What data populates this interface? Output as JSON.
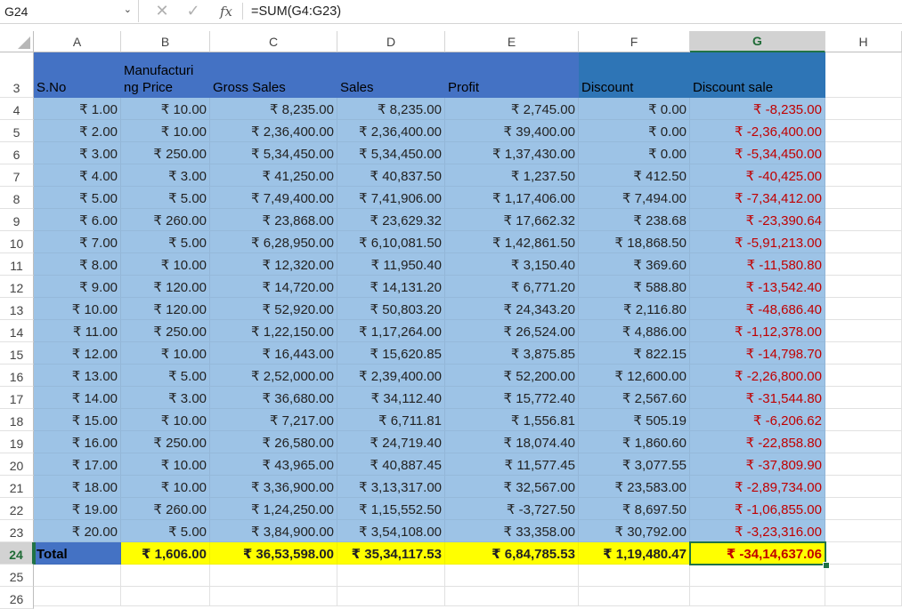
{
  "formula_bar": {
    "name_box": "G24",
    "fx_label": "fx",
    "formula": "=SUM(G4:G23)",
    "cancel_glyph": "✕",
    "enter_glyph": "✓",
    "chevron": "⌄"
  },
  "columns": [
    "A",
    "B",
    "C",
    "D",
    "E",
    "F",
    "G",
    "H"
  ],
  "selected_column": "G",
  "rows": [
    "3",
    "4",
    "5",
    "6",
    "7",
    "8",
    "9",
    "10",
    "11",
    "12",
    "13",
    "14",
    "15",
    "16",
    "17",
    "18",
    "19",
    "20",
    "21",
    "22",
    "23",
    "24",
    "25",
    "26"
  ],
  "selected_row": "24",
  "headers": [
    "S.No",
    "Manufacturing Price",
    "Gross Sales",
    "Sales",
    "Profit",
    "Discount",
    "Discount sale"
  ],
  "header_display": [
    "S.No",
    "Manufacturi ng Price",
    "Gross Sales",
    "Sales",
    "Profit",
    "Discount",
    "Discount sale"
  ],
  "data": [
    [
      "₹ 1.00",
      "₹ 10.00",
      "₹ 8,235.00",
      "₹ 8,235.00",
      "₹ 2,745.00",
      "₹ 0.00",
      "₹ -8,235.00"
    ],
    [
      "₹ 2.00",
      "₹ 10.00",
      "₹ 2,36,400.00",
      "₹ 2,36,400.00",
      "₹ 39,400.00",
      "₹ 0.00",
      "₹ -2,36,400.00"
    ],
    [
      "₹ 3.00",
      "₹ 250.00",
      "₹ 5,34,450.00",
      "₹ 5,34,450.00",
      "₹ 1,37,430.00",
      "₹ 0.00",
      "₹ -5,34,450.00"
    ],
    [
      "₹ 4.00",
      "₹ 3.00",
      "₹ 41,250.00",
      "₹ 40,837.50",
      "₹ 1,237.50",
      "₹ 412.50",
      "₹ -40,425.00"
    ],
    [
      "₹ 5.00",
      "₹ 5.00",
      "₹ 7,49,400.00",
      "₹ 7,41,906.00",
      "₹ 1,17,406.00",
      "₹ 7,494.00",
      "₹ -7,34,412.00"
    ],
    [
      "₹ 6.00",
      "₹ 260.00",
      "₹ 23,868.00",
      "₹ 23,629.32",
      "₹ 17,662.32",
      "₹ 238.68",
      "₹ -23,390.64"
    ],
    [
      "₹ 7.00",
      "₹ 5.00",
      "₹ 6,28,950.00",
      "₹ 6,10,081.50",
      "₹ 1,42,861.50",
      "₹ 18,868.50",
      "₹ -5,91,213.00"
    ],
    [
      "₹ 8.00",
      "₹ 10.00",
      "₹ 12,320.00",
      "₹ 11,950.40",
      "₹ 3,150.40",
      "₹ 369.60",
      "₹ -11,580.80"
    ],
    [
      "₹ 9.00",
      "₹ 120.00",
      "₹ 14,720.00",
      "₹ 14,131.20",
      "₹ 6,771.20",
      "₹ 588.80",
      "₹ -13,542.40"
    ],
    [
      "₹ 10.00",
      "₹ 120.00",
      "₹ 52,920.00",
      "₹ 50,803.20",
      "₹ 24,343.20",
      "₹ 2,116.80",
      "₹ -48,686.40"
    ],
    [
      "₹ 11.00",
      "₹ 250.00",
      "₹ 1,22,150.00",
      "₹ 1,17,264.00",
      "₹ 26,524.00",
      "₹ 4,886.00",
      "₹ -1,12,378.00"
    ],
    [
      "₹ 12.00",
      "₹ 10.00",
      "₹ 16,443.00",
      "₹ 15,620.85",
      "₹ 3,875.85",
      "₹ 822.15",
      "₹ -14,798.70"
    ],
    [
      "₹ 13.00",
      "₹ 5.00",
      "₹ 2,52,000.00",
      "₹ 2,39,400.00",
      "₹ 52,200.00",
      "₹ 12,600.00",
      "₹ -2,26,800.00"
    ],
    [
      "₹ 14.00",
      "₹ 3.00",
      "₹ 36,680.00",
      "₹ 34,112.40",
      "₹ 15,772.40",
      "₹ 2,567.60",
      "₹ -31,544.80"
    ],
    [
      "₹ 15.00",
      "₹ 10.00",
      "₹ 7,217.00",
      "₹ 6,711.81",
      "₹ 1,556.81",
      "₹ 505.19",
      "₹ -6,206.62"
    ],
    [
      "₹ 16.00",
      "₹ 250.00",
      "₹ 26,580.00",
      "₹ 24,719.40",
      "₹ 18,074.40",
      "₹ 1,860.60",
      "₹ -22,858.80"
    ],
    [
      "₹ 17.00",
      "₹ 10.00",
      "₹ 43,965.00",
      "₹ 40,887.45",
      "₹ 11,577.45",
      "₹ 3,077.55",
      "₹ -37,809.90"
    ],
    [
      "₹ 18.00",
      "₹ 10.00",
      "₹ 3,36,900.00",
      "₹ 3,13,317.00",
      "₹ 32,567.00",
      "₹ 23,583.00",
      "₹ -2,89,734.00"
    ],
    [
      "₹ 19.00",
      "₹ 260.00",
      "₹ 1,24,250.00",
      "₹ 1,15,552.50",
      "₹ -3,727.50",
      "₹ 8,697.50",
      "₹ -1,06,855.00"
    ],
    [
      "₹ 20.00",
      "₹ 5.00",
      "₹ 3,84,900.00",
      "₹ 3,54,108.00",
      "₹ 33,358.00",
      "₹ 30,792.00",
      "₹ -3,23,316.00"
    ]
  ],
  "totals": [
    "Total",
    "₹ 1,606.00",
    "₹ 36,53,598.00",
    "₹ 35,34,117.53",
    "₹ 6,84,785.53",
    "₹ 1,19,480.47",
    "₹ -34,14,637.06"
  ],
  "colors": {
    "header_blue": "#4472c4",
    "header_blue_dark": "#2e75b6",
    "data_blue": "#9dc3e6",
    "total_yellow": "#ffff00",
    "negative_red": "#c00000",
    "excel_green": "#217346"
  }
}
